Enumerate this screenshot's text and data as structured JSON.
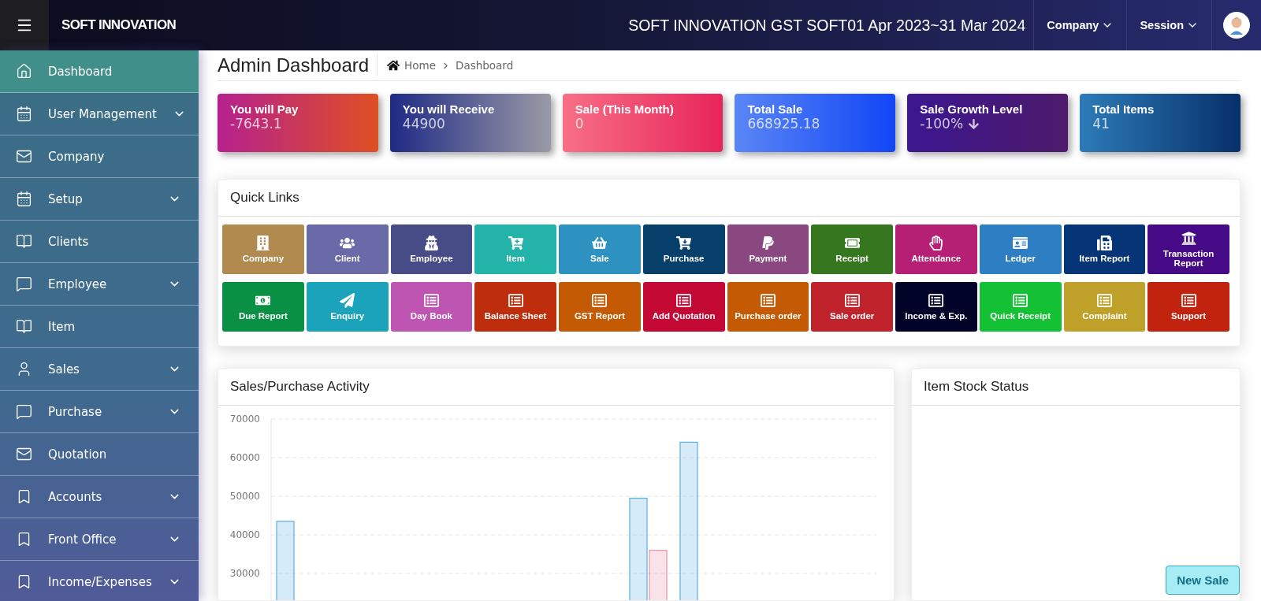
{
  "header": {
    "brand": "SOFT INNOVATION",
    "title": "SOFT INNOVATION GST SOFT01 Apr 2023~31 Mar 2024",
    "menus": [
      "Company",
      "Session"
    ]
  },
  "sidebar": {
    "items": [
      {
        "label": "Dashboard",
        "selected": true,
        "expandable": false
      },
      {
        "label": "User Management",
        "selected": false,
        "expandable": true
      },
      {
        "label": "Company",
        "selected": false,
        "expandable": false
      },
      {
        "label": "Setup",
        "selected": false,
        "expandable": true
      },
      {
        "label": "Clients",
        "selected": false,
        "expandable": false
      },
      {
        "label": "Employee",
        "selected": false,
        "expandable": true
      },
      {
        "label": "Item",
        "selected": false,
        "expandable": false
      },
      {
        "label": "Sales",
        "selected": false,
        "expandable": true
      },
      {
        "label": "Purchase",
        "selected": false,
        "expandable": true
      },
      {
        "label": "Quotation",
        "selected": false,
        "expandable": false
      },
      {
        "label": "Accounts",
        "selected": false,
        "expandable": true
      },
      {
        "label": "Front Office",
        "selected": false,
        "expandable": true
      },
      {
        "label": "Income/Expenses",
        "selected": false,
        "expandable": true
      }
    ]
  },
  "page_title": "Admin Dashboard",
  "breadcrumb": [
    "Home",
    "Dashboard"
  ],
  "stats": [
    {
      "label": "You will Pay",
      "value": "-7643.1"
    },
    {
      "label": "You will Receive",
      "value": "44900"
    },
    {
      "label": "Sale (This Month)",
      "value": "0"
    },
    {
      "label": "Total Sale",
      "value": "668925.18"
    },
    {
      "label": "Sale Growth Level",
      "value": "-100%",
      "trend_down": true
    },
    {
      "label": "Total Items",
      "value": "41"
    }
  ],
  "quick_links": {
    "title": "Quick Links",
    "items": [
      {
        "label": "Company",
        "color": "#b08a4e"
      },
      {
        "label": "Client",
        "color": "#6a6aa8"
      },
      {
        "label": "Employee",
        "color": "#484c86"
      },
      {
        "label": "Item",
        "color": "#24b3a8"
      },
      {
        "label": "Sale",
        "color": "#2e92c0"
      },
      {
        "label": "Purchase",
        "color": "#053f6a"
      },
      {
        "label": "Payment",
        "color": "#8a4880"
      },
      {
        "label": "Receipt",
        "color": "#35771f"
      },
      {
        "label": "Attendance",
        "color": "#b51f74"
      },
      {
        "label": "Ledger",
        "color": "#2e7ec4"
      },
      {
        "label": "Item Report",
        "color": "#053577"
      },
      {
        "label": "Transaction Report",
        "color": "#460a86"
      },
      {
        "label": "Due Report",
        "color": "#0a9044"
      },
      {
        "label": "Enquiry",
        "color": "#1aa3ba"
      },
      {
        "label": "Day Book",
        "color": "#be55b3"
      },
      {
        "label": "Balance Sheet",
        "color": "#bf2e0c"
      },
      {
        "label": "GST Report",
        "color": "#c45a04"
      },
      {
        "label": "Add Quotation",
        "color": "#c30833"
      },
      {
        "label": "Purchase order",
        "color": "#c45a04"
      },
      {
        "label": "Sale order",
        "color": "#c1232c"
      },
      {
        "label": "Income & Exp.",
        "color": "#020329"
      },
      {
        "label": "Quick Receipt",
        "color": "#14c135"
      },
      {
        "label": "Complaint",
        "color": "#bfa12a"
      },
      {
        "label": "Support",
        "color": "#c1230f"
      }
    ]
  },
  "activity": {
    "title": "Sales/Purchase Activity",
    "chart_data": {
      "type": "bar",
      "ylim": [
        0,
        70000
      ],
      "grid": true,
      "yticks": [
        30000,
        40000,
        50000,
        60000,
        70000
      ],
      "series": [
        {
          "color": "#5ab0e0",
          "values": [
            43500,
            0,
            0,
            0,
            0,
            0,
            0,
            49500,
            64000,
            0,
            0,
            0
          ]
        },
        {
          "color": "#e891a8",
          "values": [
            0,
            0,
            0,
            0,
            0,
            0,
            0,
            36000,
            0,
            0,
            0,
            0
          ]
        }
      ]
    }
  },
  "stock": {
    "title": "Item Stock Status"
  },
  "new_sale_button": "New Sale"
}
